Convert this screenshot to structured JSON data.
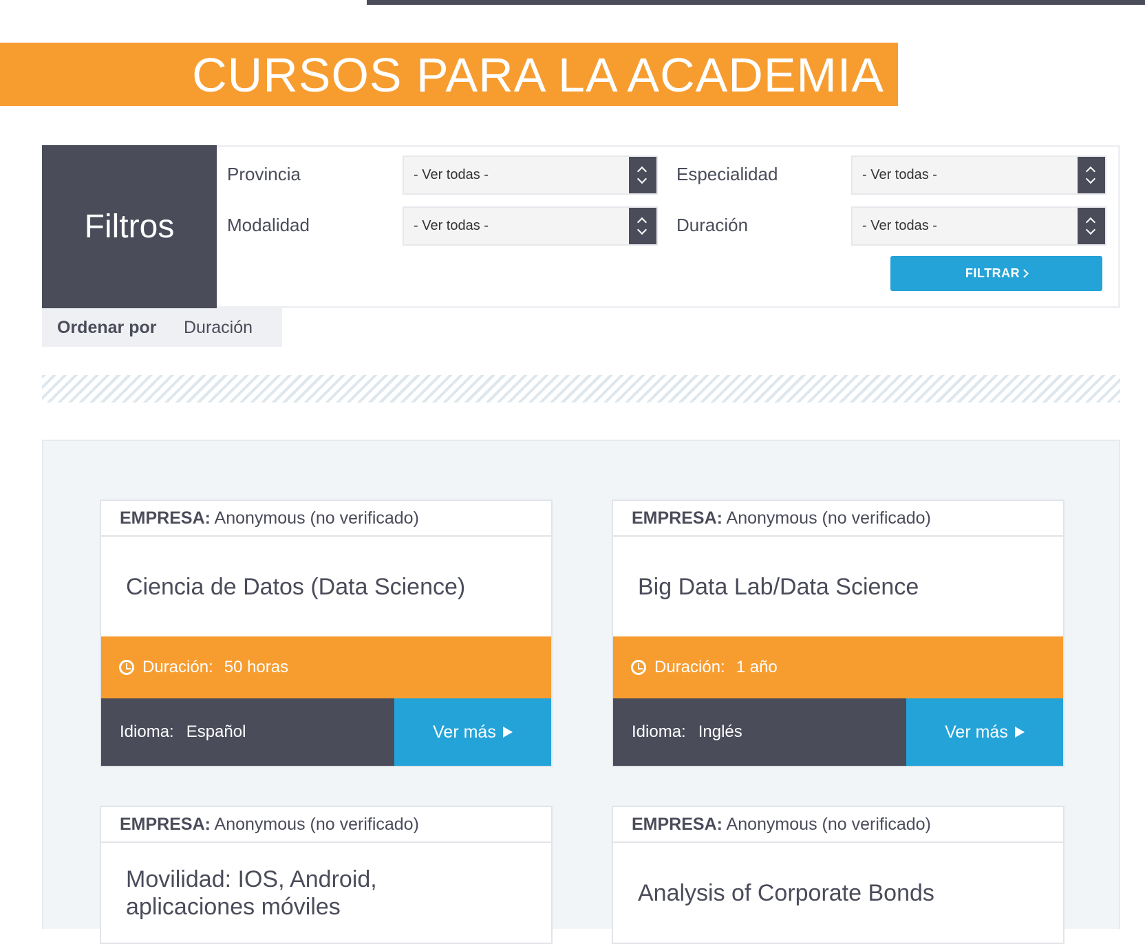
{
  "hero": {
    "title": "CURSOS PARA LA ACADEMIA"
  },
  "filters": {
    "heading": "Filtros",
    "fields": [
      {
        "label": "Provincia",
        "value": "- Ver todas -"
      },
      {
        "label": "Especialidad",
        "value": "- Ver todas -"
      },
      {
        "label": "Modalidad",
        "value": "- Ver todas -"
      },
      {
        "label": "Duración",
        "value": "- Ver todas -"
      }
    ],
    "button_label": "FILTRAR"
  },
  "sort": {
    "label": "Ordenar por",
    "value": "Duración"
  },
  "courses": [
    {
      "company_label": "EMPRESA:",
      "company": "Anonymous (no verificado)",
      "title": "Ciencia de Datos (Data Science)",
      "duration_label": "Duración:",
      "duration": "50 horas",
      "language_label": "Idioma:",
      "language": "Español",
      "more_label": "Ver más"
    },
    {
      "company_label": "EMPRESA:",
      "company": "Anonymous (no verificado)",
      "title": "Big Data Lab/Data Science",
      "duration_label": "Duración:",
      "duration": "1 año",
      "language_label": "Idioma:",
      "language": "Inglés",
      "more_label": "Ver más"
    },
    {
      "company_label": "EMPRESA:",
      "company": "Anonymous (no verificado)",
      "title": "Movilidad: IOS, Android, aplicaciones móviles"
    },
    {
      "company_label": "EMPRESA:",
      "company": "Anonymous (no verificado)",
      "title": "Analysis of Corporate Bonds"
    }
  ],
  "colors": {
    "accent_orange": "#f79d30",
    "dark_slate": "#4a4c5a",
    "action_blue": "#23a3d8",
    "panel_bg": "#f2f5f8"
  },
  "icons": {
    "select_arrows": "updown-chevron-icon",
    "filter_chevron": "chevron-right-icon",
    "duration": "clock-icon",
    "more": "play-icon"
  }
}
